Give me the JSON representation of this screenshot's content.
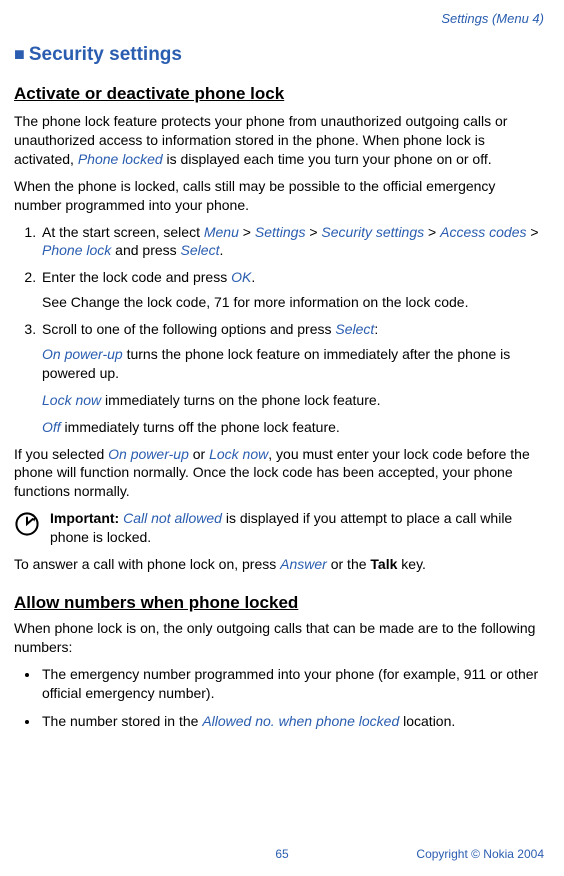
{
  "header": {
    "breadcrumb": "Settings (Menu 4)"
  },
  "section": {
    "square": "■",
    "title": "Security settings"
  },
  "sub1": {
    "heading": "Activate or deactivate phone lock",
    "p1a": "The phone lock feature protects your phone from unauthorized outgoing calls or unauthorized access to information stored in the phone. When phone lock is activated, ",
    "p1b": "Phone locked",
    "p1c": " is displayed each time you turn your phone on or off.",
    "p2": "When the phone is locked, calls still may be possible to the official emergency number programmed into your phone.",
    "ol": {
      "i1": {
        "a": "At the start screen, select ",
        "menu": "Menu",
        "gt1": " > ",
        "settings": "Settings",
        "gt2": " > ",
        "sec": "Security settings",
        "gt3": " > ",
        "acc": "Access codes",
        "gt4": " > ",
        "pl": "Phone lock",
        "b": " and press ",
        "sel": "Select",
        "dot": "."
      },
      "i2": {
        "a": "Enter the lock code and press ",
        "ok": "OK",
        "dot": ".",
        "sub": "See Change the lock code, 71 for more information on the lock code."
      },
      "i3": {
        "a": "Scroll to one of the following options and press ",
        "sel": "Select",
        "colon": ":",
        "opt1a": "On power-up",
        "opt1b": " turns the phone lock feature on immediately after the phone is powered up.",
        "opt2a": "Lock now",
        "opt2b": " immediately turns on the phone lock feature.",
        "opt3a": "Off",
        "opt3b": " immediately turns off the phone lock feature."
      }
    },
    "p3a": "If you selected ",
    "p3b": "On power-up",
    "p3c": " or ",
    "p3d": "Lock now",
    "p3e": ", you must enter your lock code before the phone will function normally. Once the lock code has been accepted, your phone functions normally.",
    "important_label": "Important:",
    "important_a": " ",
    "important_b": "Call not allowed",
    "important_c": " is displayed if you attempt to place a call while phone is locked.",
    "p4a": "To answer a call with phone lock on, press ",
    "p4b": "Answer",
    "p4c": " or the ",
    "p4d": "Talk",
    "p4e": " key."
  },
  "sub2": {
    "heading": "Allow numbers when phone locked",
    "p1": "When phone lock is on, the only outgoing calls that can be made are to the following numbers:",
    "b1": "The emergency number programmed into your phone (for example, 911 or other official emergency number).",
    "b2a": "The number stored in the ",
    "b2b": "Allowed no. when phone locked",
    "b2c": " location."
  },
  "footer": {
    "page": "65",
    "copy": "Copyright © Nokia 2004"
  }
}
